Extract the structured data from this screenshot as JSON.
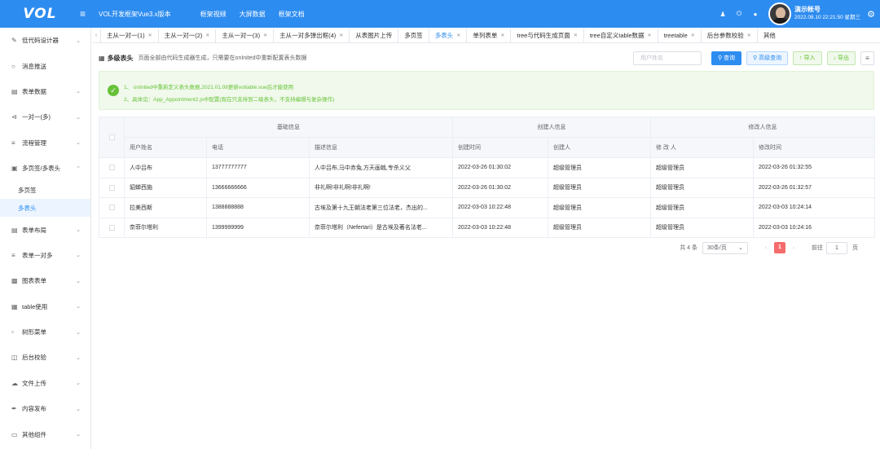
{
  "header": {
    "logo": "VOL",
    "app_title": "VOL开发框架Vue3.x版本",
    "nav": [
      "框架视频",
      "大屏数据",
      "框架文档"
    ],
    "user_name": "演示帐号",
    "user_time": "2022.08.10 22:21:50 星期三",
    "accent": "#2d8cf0"
  },
  "sidebar": {
    "items": [
      {
        "label": "低代码设计器",
        "icon": "edit-icon"
      },
      {
        "label": "消息推送",
        "icon": "message-icon"
      },
      {
        "label": "表单数据",
        "icon": "form-icon"
      },
      {
        "label": "一对一(多)",
        "icon": "share-icon"
      },
      {
        "label": "流程管理",
        "icon": "sliders-icon"
      },
      {
        "label": "多页签/多表头",
        "icon": "tabs-icon",
        "expanded": true,
        "children": [
          {
            "label": "多页签"
          },
          {
            "label": "多表头",
            "active": true
          }
        ]
      },
      {
        "label": "表单布局",
        "icon": "layout-icon"
      },
      {
        "label": "表单一对多",
        "icon": "sliders-icon"
      },
      {
        "label": "图表表单",
        "icon": "chart-icon"
      },
      {
        "label": "table使用",
        "icon": "table-icon"
      },
      {
        "label": "树形菜单",
        "icon": "tree-icon"
      },
      {
        "label": "后台校验",
        "icon": "copy-icon"
      },
      {
        "label": "文件上传",
        "icon": "upload-icon"
      },
      {
        "label": "内容发布",
        "icon": "pen-icon"
      },
      {
        "label": "其他组件",
        "icon": "folder-icon"
      }
    ]
  },
  "tabs": [
    {
      "label": "主从一对一(1)"
    },
    {
      "label": "主从一对一(2)"
    },
    {
      "label": "主从一对一(3)"
    },
    {
      "label": "主从一对多弹出框(4)"
    },
    {
      "label": "从表图片上传"
    },
    {
      "label": "多页签"
    },
    {
      "label": "多表头",
      "active": true
    },
    {
      "label": "单列表单"
    },
    {
      "label": "tree与代码生成页面"
    },
    {
      "label": "tree自定义table数据"
    },
    {
      "label": "treetable"
    },
    {
      "label": "后台参数校验"
    },
    {
      "label": "其他"
    }
  ],
  "toolbar": {
    "title": "多级表头",
    "desc": "页面全部由代码生成器生成，只需要在onInited中重新配置表头数据",
    "search_placeholder": "用户姓名",
    "query": "查询",
    "advanced": "高级查询",
    "import": "导入",
    "export": "导出"
  },
  "alert": {
    "line1": "1、 onInited中重新定义表头数据,2021.01.08更新voltable.vue后才能使用",
    "line2": "2、具体见：App_Appointment2.js中配置(现在只支持到二级表头，不支持编辑与复杂操作)"
  },
  "table": {
    "groups": [
      "基础信息",
      "创建人信息",
      "修改人信息"
    ],
    "columns": [
      "用户姓名",
      "电话",
      "描述信息",
      "创建时间",
      "创建人",
      "修 改 人",
      "修改时间"
    ],
    "rows": [
      [
        "人中吕布",
        "13777777777",
        "人中吕布,马中赤兔,方天画戟,专杀义父",
        "2022-03-26 01:30:02",
        "超级管理员",
        "超级管理员",
        "2022-03-26 01:32:55"
      ],
      [
        "貂蝉西施",
        "13666666666",
        "非礼啊!非礼啊!非礼啊!",
        "2022-03-26 01:30:02",
        "超级管理员",
        "超级管理员",
        "2022-03-26 01:32:57"
      ],
      [
        "拉美西斯",
        "1388888888",
        "古埃及第十九王朝法老第三位法老，杰出的...",
        "2022-03-03 10:22:48",
        "超级管理员",
        "超级管理员",
        "2022-03-03 10:24:14"
      ],
      [
        "奈菲尔塔利",
        "1399999999",
        "奈菲尔塔利（Nefertari）是古埃及著名法老...",
        "2022-03-03 10:22:48",
        "超级管理员",
        "超级管理员",
        "2022-03-03 10:24:16"
      ]
    ]
  },
  "pager": {
    "total": "共 4 条",
    "page_size": "30条/页",
    "current": "1",
    "goto_label": "前往",
    "goto_value": "1",
    "unit": "页"
  }
}
